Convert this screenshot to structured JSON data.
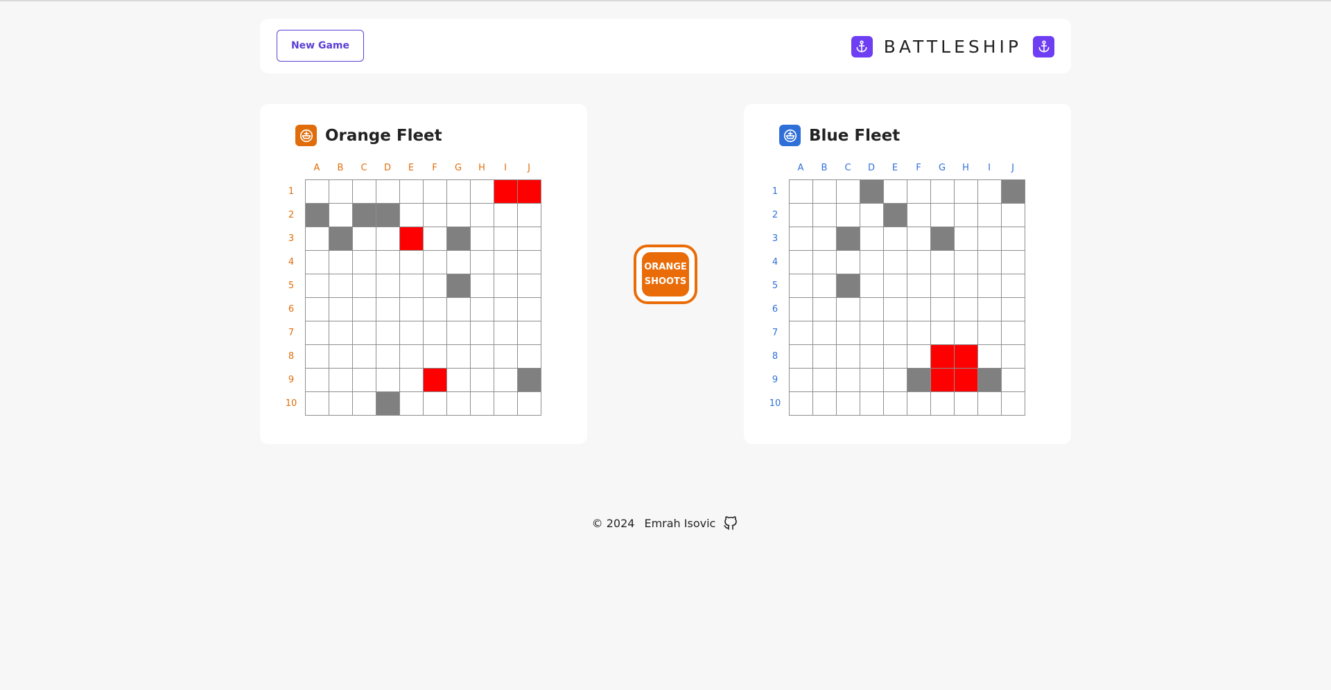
{
  "header": {
    "new_game_label": "New Game",
    "title": "BATTLESHIP",
    "left_icon": "anchor-icon",
    "right_icon": "anchor-icon",
    "accent_color": "#6d3ef2"
  },
  "boards": {
    "columns": [
      "A",
      "B",
      "C",
      "D",
      "E",
      "F",
      "G",
      "H",
      "I",
      "J"
    ],
    "rows": [
      "1",
      "2",
      "3",
      "4",
      "5",
      "6",
      "7",
      "8",
      "9",
      "10"
    ],
    "orange": {
      "title": "Orange Fleet",
      "icon": "ship-icon",
      "color": "#e06d0a",
      "grid": [
        "........HH",
        "S.SS......",
        ".S..H.S...",
        "..........",
        "......S...",
        "..........",
        "..........",
        "..........",
        ".....H...S",
        "...S......"
      ]
    },
    "blue": {
      "title": "Blue Fleet",
      "icon": "ship-icon",
      "color": "#2f6fd8",
      "grid": [
        "...S.....S",
        "....S.....",
        "..S...S...",
        "..........",
        "..S.......",
        "..........",
        "..........",
        "......HH..",
        ".....SHHS.",
        ".........."
      ]
    },
    "legend": {
      "S": "ship",
      "H": "hit",
      ".": "empty"
    },
    "colors": {
      "ship": "#808080",
      "hit": "#ff0000",
      "empty": "#ffffff"
    }
  },
  "turn": {
    "line1": "ORANGE",
    "line2": "SHOOTS",
    "color": "#ea6c08"
  },
  "footer": {
    "copyright": "© 2024",
    "author": "Emrah Isovic",
    "icon": "github-icon"
  }
}
